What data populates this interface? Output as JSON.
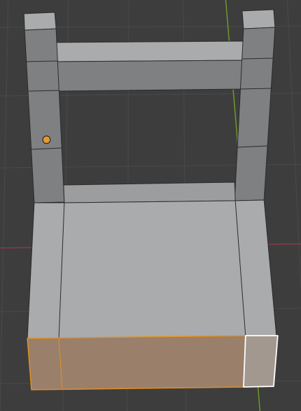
{
  "viewport": {
    "background": "#3d3d3d",
    "grid_color": "#4a4a4a",
    "axis_x_color": "#8b3a46",
    "axis_y_color": "#6f9a2a"
  },
  "mesh": {
    "face_light": "#a9abad",
    "face_mid": "#9b9d9f",
    "face_dark": "#7e8082",
    "edge_color": "#2a2a2a",
    "selected_face_color": "#9a7f6b",
    "active_face_color": "#a39890",
    "selection_edge_color": "#e3901f",
    "active_edge_color": "#ffffff"
  },
  "origin_marker": {
    "fill": "#e89a2c",
    "stroke": "#2a2a2a"
  }
}
